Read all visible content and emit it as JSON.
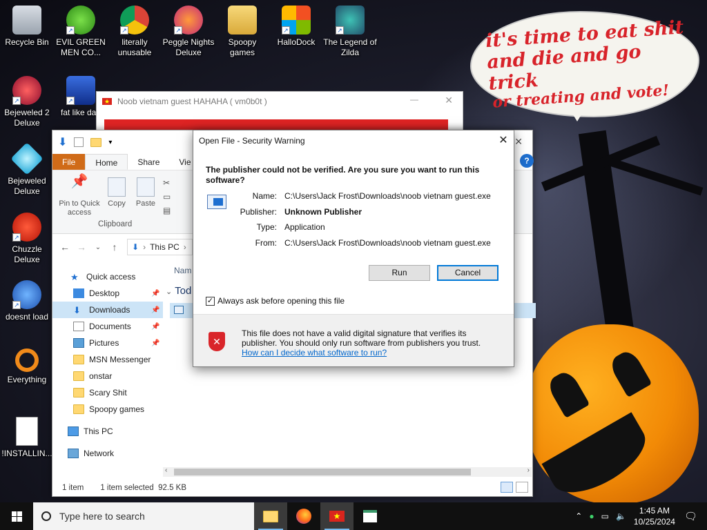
{
  "wallpaper": {
    "speech_line1": "it's time to eat shit",
    "speech_line2": "and die and go trick",
    "speech_line3": "or treating and vote!"
  },
  "desktop_icons": [
    {
      "label": "Recycle Bin",
      "icon": "recycle-bin-icon"
    },
    {
      "label": "EVIL GREEN MEN CO...",
      "icon": "green-men-icon"
    },
    {
      "label": "literally unusable",
      "icon": "chrome-icon"
    },
    {
      "label": "Peggle Nights Deluxe",
      "icon": "peggle-icon"
    },
    {
      "label": "Spoopy games",
      "icon": "folder-icon"
    },
    {
      "label": "HalloDock",
      "icon": "windows-icon"
    },
    {
      "label": "The Legend of Zilda",
      "icon": "zilda-icon"
    },
    {
      "label": "Bejeweled 2 Deluxe",
      "icon": "bejeweled2-icon"
    },
    {
      "label": "fat like darl",
      "icon": "mpl-icon"
    },
    {
      "label": "Bejeweled Deluxe",
      "icon": "bejeweled-icon"
    },
    {
      "label": "Chuzzle Deluxe",
      "icon": "chuzzle-icon"
    },
    {
      "label": "doesnt load",
      "icon": "thunderbird-icon"
    },
    {
      "label": "Everything",
      "icon": "everything-icon"
    },
    {
      "label": "!INSTALLIN...",
      "icon": "text-file-icon"
    }
  ],
  "noob_window": {
    "title": "Noob vietnam guest HAHAHA ( vm0b0t )"
  },
  "explorer": {
    "tabs": [
      "File",
      "Home",
      "Share",
      "Vie"
    ],
    "ribbon": {
      "pin": "Pin to Quick access",
      "copy": "Copy",
      "paste": "Paste",
      "group": "Clipboard"
    },
    "address": "This PC",
    "column_name": "Nam",
    "group_today": "Tod",
    "nav": [
      {
        "label": "Quick access",
        "pinned": false
      },
      {
        "label": "Desktop",
        "pinned": true
      },
      {
        "label": "Downloads",
        "pinned": true
      },
      {
        "label": "Documents",
        "pinned": true
      },
      {
        "label": "Pictures",
        "pinned": true
      },
      {
        "label": "MSN Messenger",
        "pinned": false
      },
      {
        "label": "onstar",
        "pinned": false
      },
      {
        "label": "Scary Shit",
        "pinned": false
      },
      {
        "label": "Spoopy games",
        "pinned": false
      },
      {
        "label": "This PC",
        "pinned": false
      },
      {
        "label": "Network",
        "pinned": false
      }
    ],
    "status": {
      "count": "1 item",
      "selected": "1 item selected",
      "size": "92.5 KB"
    }
  },
  "dialog": {
    "title": "Open File - Security Warning",
    "question": "The publisher could not be verified.  Are you sure you want to run this software?",
    "fields": [
      {
        "label": "Name:",
        "value": "C:\\Users\\Jack Frost\\Downloads\\noob vietnam guest.exe",
        "bold": false
      },
      {
        "label": "Publisher:",
        "value": "Unknown Publisher",
        "bold": true
      },
      {
        "label": "Type:",
        "value": "Application",
        "bold": false
      },
      {
        "label": "From:",
        "value": "C:\\Users\\Jack Frost\\Downloads\\noob vietnam guest.exe",
        "bold": false
      }
    ],
    "run_label": "Run",
    "cancel_label": "Cancel",
    "checkbox_label": "Always ask before opening this file",
    "checkbox_checked": true,
    "warning_text": "This file does not have a valid digital signature that verifies its publisher.  You should only run software from publishers you trust.",
    "help_link": "How can I decide what software to run?"
  },
  "taskbar": {
    "search_placeholder": "Type here to search",
    "apps": [
      "file-explorer-icon",
      "firefox-icon",
      "vietnam-flag-icon",
      "notepad-icon"
    ],
    "time": "1:45 AM",
    "date": "10/25/2024"
  },
  "colors": {
    "accent": "#0078d7",
    "file_tab": "#d06b18",
    "taskbar": "#101010",
    "speech_text": "#d8232a"
  }
}
